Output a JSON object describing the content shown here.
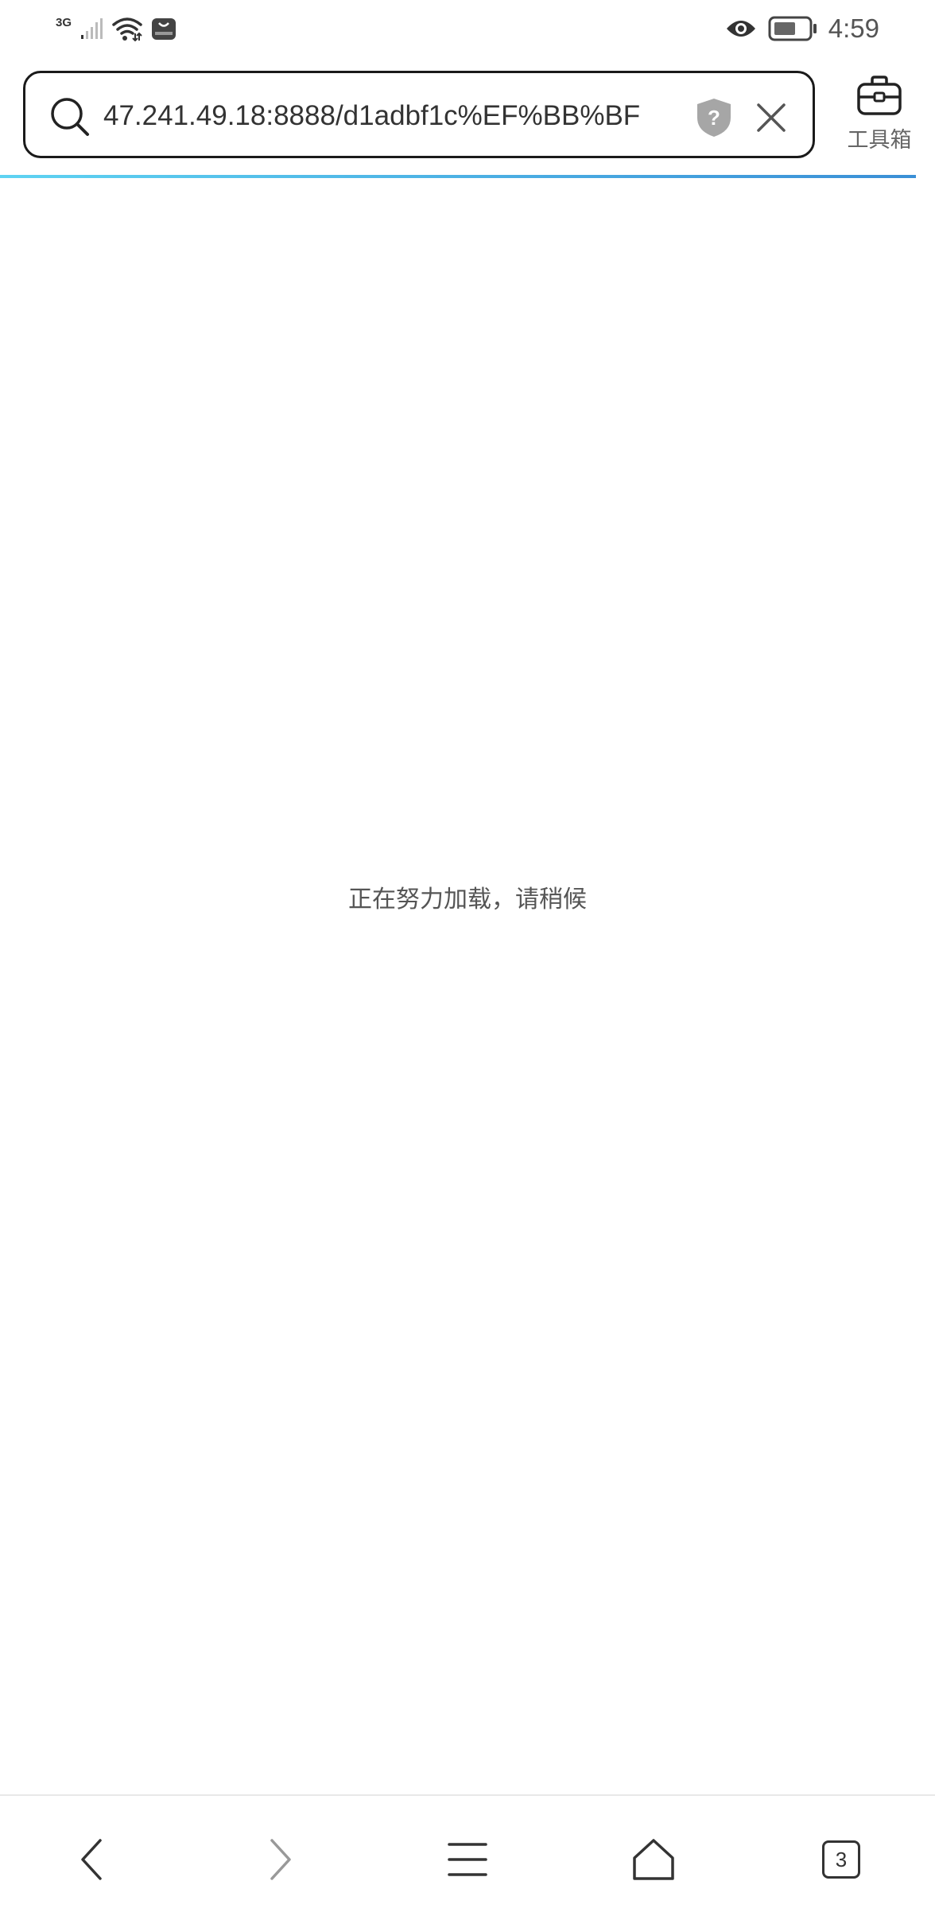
{
  "status_bar": {
    "network_type": "3G",
    "time": "4:59",
    "icons": [
      "signal-icon",
      "wifi-icon",
      "huawei-store-icon",
      "eye-icon",
      "battery-icon"
    ]
  },
  "address_bar": {
    "url": "47.241.49.18:8888/d1adbf1c%EF%BB%BF",
    "security_icon": "shield-question-icon",
    "toolbox_label": "工具箱"
  },
  "content": {
    "loading_message": "正在努力加载，请稍候"
  },
  "bottom_nav": {
    "tab_count": "3",
    "icons": [
      "back-icon",
      "forward-icon",
      "menu-icon",
      "home-icon",
      "tabs-icon"
    ]
  },
  "colors": {
    "progress_start": "#5ed3f2",
    "progress_end": "#3a8fd6",
    "url_border": "#1a1a1a"
  }
}
